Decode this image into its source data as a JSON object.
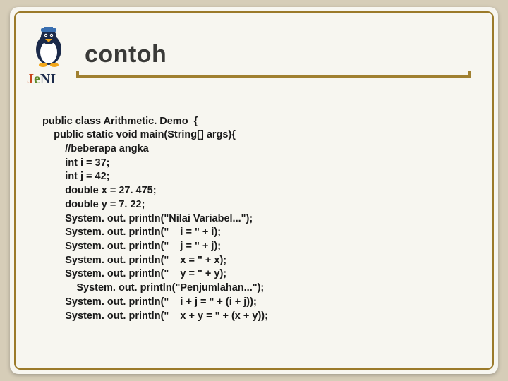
{
  "slide": {
    "title": "contoh",
    "logo_alt": "JeNI penguin logo",
    "code_lines": [
      "public class Arithmetic. Demo  {",
      "    public static void main(String[] args){",
      "        //beberapa angka",
      "        int i = 37;",
      "        int j = 42;",
      "        double x = 27. 475;",
      "        double y = 7. 22;",
      "        System. out. println(\"Nilai Variabel...\");",
      "        System. out. println(\"    i = \" + i);",
      "        System. out. println(\"    j = \" + j);",
      "        System. out. println(\"    x = \" + x);",
      "        System. out. println(\"    y = \" + y);",
      "            System. out. println(\"Penjumlahan...\");",
      "        System. out. println(\"    i + j = \" + (i + j));",
      "        System. out. println(\"    x + y = \" + (x + y));"
    ]
  },
  "colors": {
    "page_bg": "#d6cdb8",
    "slide_bg": "#f7f6f0",
    "accent": "#9b7a2a",
    "text": "#1a1a1a"
  }
}
